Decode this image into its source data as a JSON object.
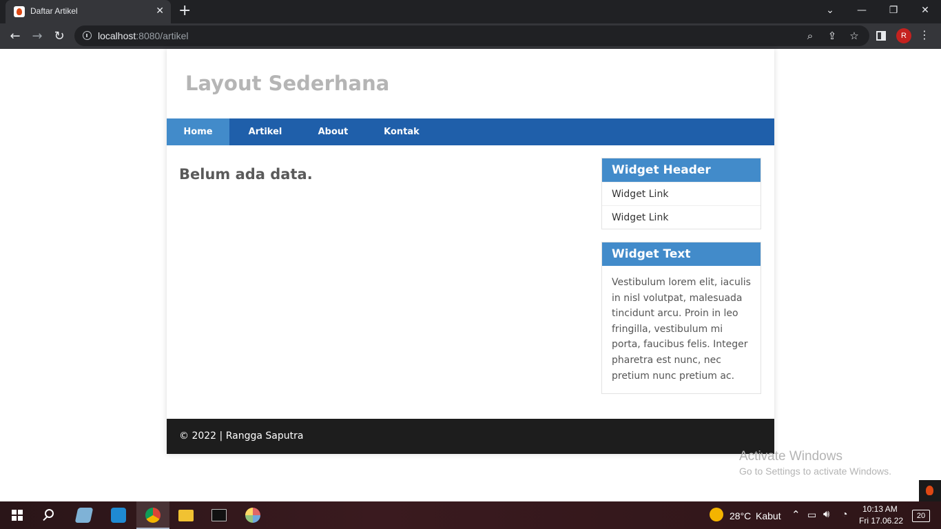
{
  "browser": {
    "tab_title": "Daftar Artikel",
    "url_host": "localhost",
    "url_rest": ":8080/artikel",
    "profile_initial": "R"
  },
  "site": {
    "title": "Layout Sederhana",
    "nav": [
      "Home",
      "Artikel",
      "About",
      "Kontak"
    ],
    "active_nav": "Home",
    "main_message": "Belum ada data.",
    "widgets": {
      "header": {
        "title": "Widget Header",
        "links": [
          "Widget Link",
          "Widget Link"
        ]
      },
      "text": {
        "title": "Widget Text",
        "body": "Vestibulum lorem elit, iaculis in nisl volutpat, malesuada tincidunt arcu. Proin in leo fringilla, vestibulum mi porta, faucibus felis. Integer pharetra est nunc, nec pretium nunc pretium ac."
      }
    },
    "footer": "© 2022 | Rangga Saputra"
  },
  "watermark": {
    "title": "Activate Windows",
    "subtitle": "Go to Settings to activate Windows."
  },
  "taskbar": {
    "weather": "28°C",
    "weather_desc": "Kabut",
    "time": "10:13 AM",
    "date": "Fri 17.06.22",
    "notifications": "20"
  },
  "colors": {
    "nav_bg": "#1f5faa",
    "nav_active": "#428bca",
    "widget_header": "#428bca",
    "footer_bg": "#1d1d1d",
    "site_title": "#b5b5b5"
  }
}
